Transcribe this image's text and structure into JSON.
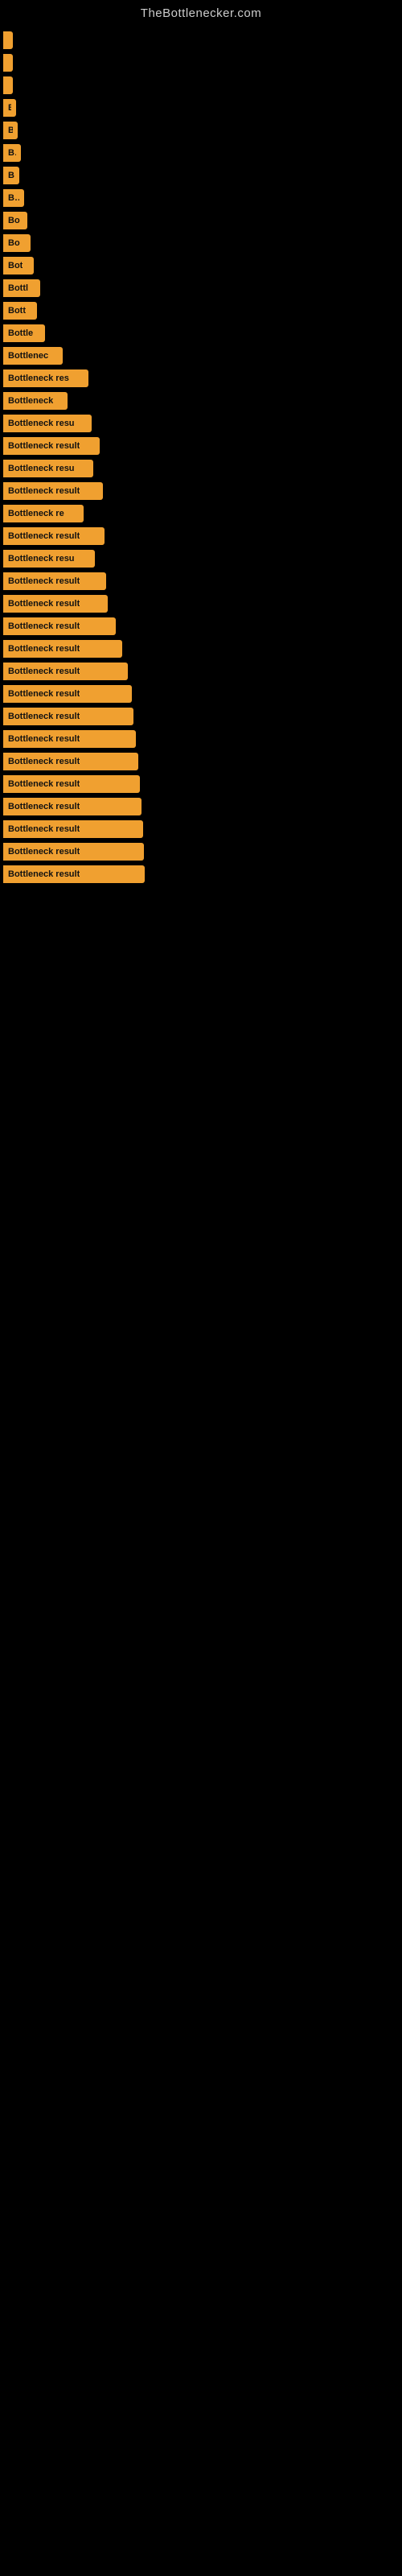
{
  "site_title": "TheBottlenecker.com",
  "bars": [
    {
      "id": 1,
      "label": "",
      "width": 4
    },
    {
      "id": 2,
      "label": "",
      "width": 6
    },
    {
      "id": 3,
      "label": "",
      "width": 8
    },
    {
      "id": 4,
      "label": "B",
      "width": 16
    },
    {
      "id": 5,
      "label": "B",
      "width": 18
    },
    {
      "id": 6,
      "label": "Bo",
      "width": 22
    },
    {
      "id": 7,
      "label": "B",
      "width": 20
    },
    {
      "id": 8,
      "label": "Bo",
      "width": 26
    },
    {
      "id": 9,
      "label": "Bo",
      "width": 30
    },
    {
      "id": 10,
      "label": "Bo",
      "width": 34
    },
    {
      "id": 11,
      "label": "Bot",
      "width": 38
    },
    {
      "id": 12,
      "label": "Bottl",
      "width": 46
    },
    {
      "id": 13,
      "label": "Bott",
      "width": 42
    },
    {
      "id": 14,
      "label": "Bottle",
      "width": 52
    },
    {
      "id": 15,
      "label": "Bottlenec",
      "width": 74
    },
    {
      "id": 16,
      "label": "Bottleneck res",
      "width": 106
    },
    {
      "id": 17,
      "label": "Bottleneck",
      "width": 80
    },
    {
      "id": 18,
      "label": "Bottleneck resu",
      "width": 110
    },
    {
      "id": 19,
      "label": "Bottleneck result",
      "width": 120
    },
    {
      "id": 20,
      "label": "Bottleneck resu",
      "width": 112
    },
    {
      "id": 21,
      "label": "Bottleneck result",
      "width": 124
    },
    {
      "id": 22,
      "label": "Bottleneck re",
      "width": 100
    },
    {
      "id": 23,
      "label": "Bottleneck result",
      "width": 126
    },
    {
      "id": 24,
      "label": "Bottleneck resu",
      "width": 114
    },
    {
      "id": 25,
      "label": "Bottleneck result",
      "width": 128
    },
    {
      "id": 26,
      "label": "Bottleneck result",
      "width": 130
    },
    {
      "id": 27,
      "label": "Bottleneck result",
      "width": 140
    },
    {
      "id": 28,
      "label": "Bottleneck result",
      "width": 148
    },
    {
      "id": 29,
      "label": "Bottleneck result",
      "width": 155
    },
    {
      "id": 30,
      "label": "Bottleneck result",
      "width": 160
    },
    {
      "id": 31,
      "label": "Bottleneck result",
      "width": 162
    },
    {
      "id": 32,
      "label": "Bottleneck result",
      "width": 165
    },
    {
      "id": 33,
      "label": "Bottleneck result",
      "width": 168
    },
    {
      "id": 34,
      "label": "Bottleneck result",
      "width": 170
    },
    {
      "id": 35,
      "label": "Bottleneck result",
      "width": 172
    },
    {
      "id": 36,
      "label": "Bottleneck result",
      "width": 174
    },
    {
      "id": 37,
      "label": "Bottleneck result",
      "width": 175
    },
    {
      "id": 38,
      "label": "Bottleneck result",
      "width": 176
    }
  ]
}
